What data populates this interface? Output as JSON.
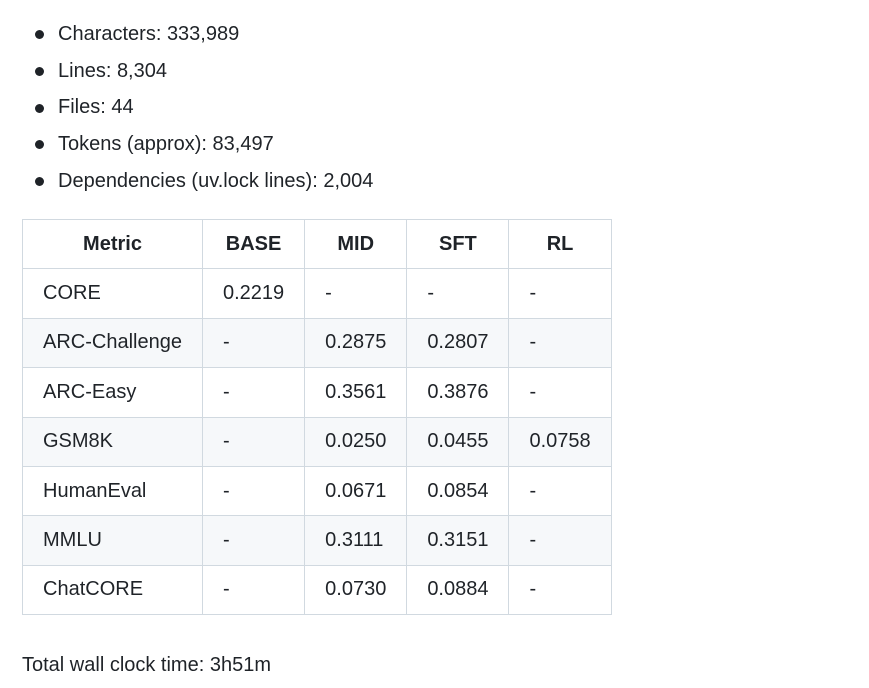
{
  "stats": [
    {
      "label": "Characters",
      "value": "333,989"
    },
    {
      "label": "Lines",
      "value": "8,304"
    },
    {
      "label": "Files",
      "value": "44"
    },
    {
      "label": "Tokens (approx)",
      "value": "83,497"
    },
    {
      "label": "Dependencies (uv.lock lines)",
      "value": "2,004"
    }
  ],
  "table": {
    "headers": [
      "Metric",
      "BASE",
      "MID",
      "SFT",
      "RL"
    ],
    "rows": [
      [
        "CORE",
        "0.2219",
        "-",
        "-",
        "-"
      ],
      [
        "ARC-Challenge",
        "-",
        "0.2875",
        "0.2807",
        "-"
      ],
      [
        "ARC-Easy",
        "-",
        "0.3561",
        "0.3876",
        "-"
      ],
      [
        "GSM8K",
        "-",
        "0.0250",
        "0.0455",
        "0.0758"
      ],
      [
        "HumanEval",
        "-",
        "0.0671",
        "0.0854",
        "-"
      ],
      [
        "MMLU",
        "-",
        "0.3111",
        "0.3151",
        "-"
      ],
      [
        "ChatCORE",
        "-",
        "0.0730",
        "0.0884",
        "-"
      ]
    ]
  },
  "footer": {
    "label": "Total wall clock time",
    "value": "3h51m"
  }
}
